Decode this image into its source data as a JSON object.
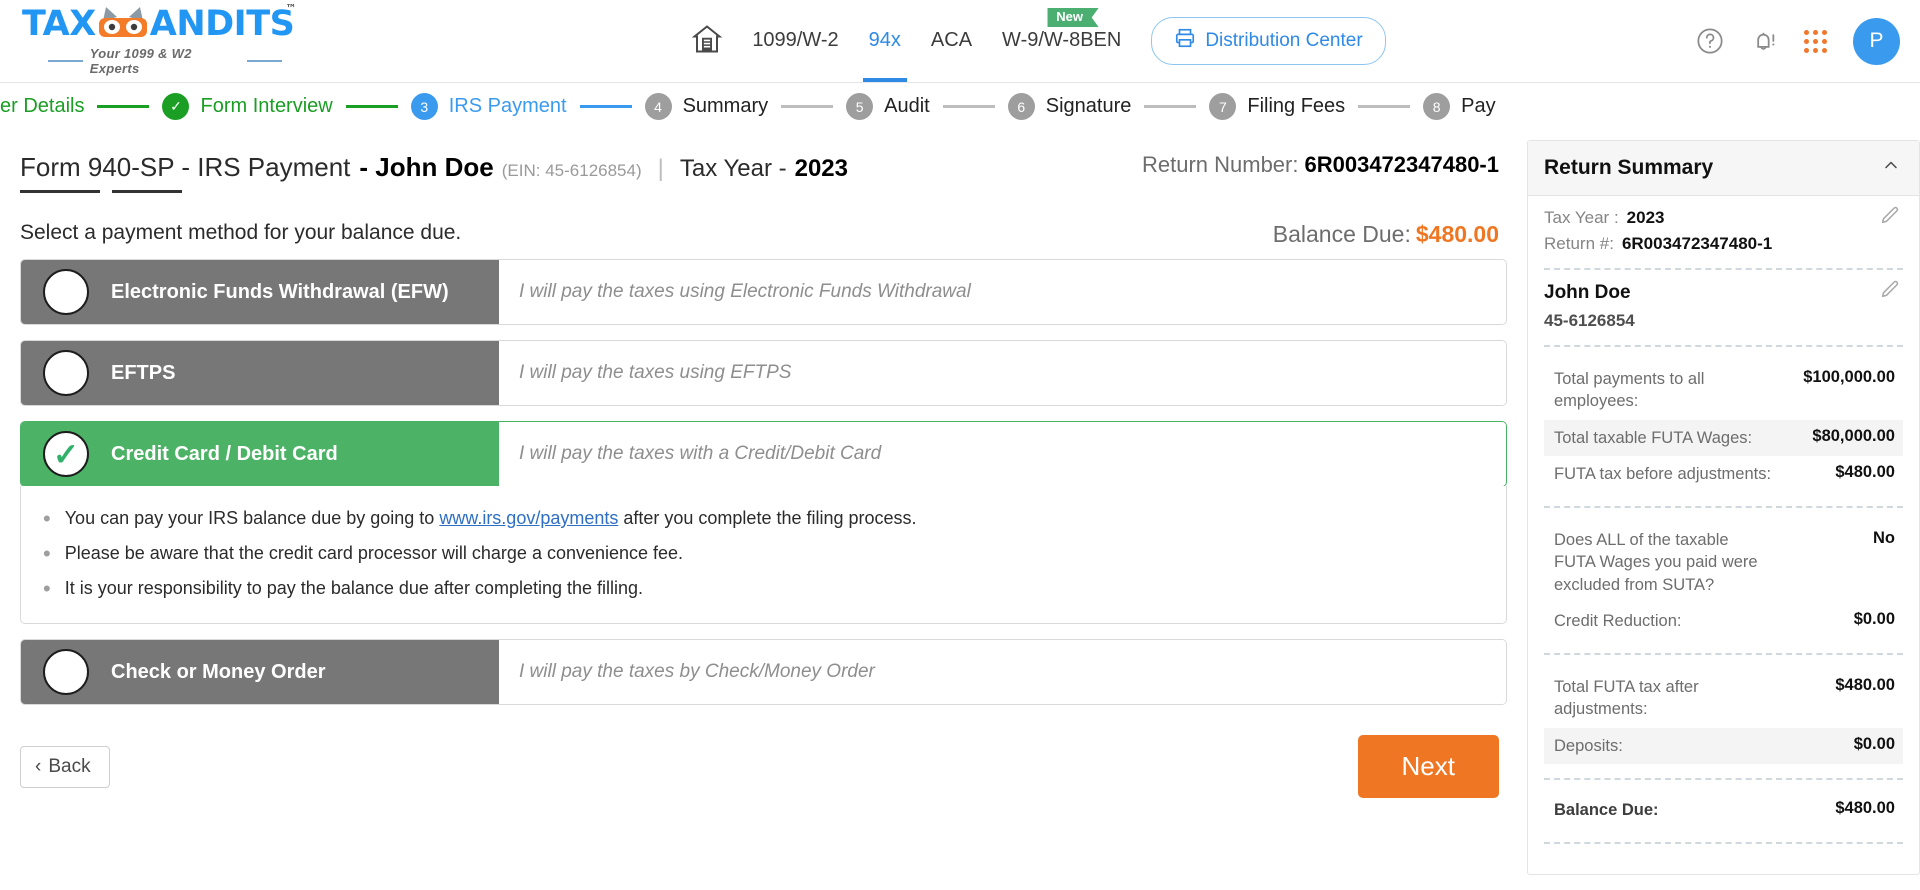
{
  "header": {
    "logo": {
      "text_main": "TAX ANDITS",
      "trademark": "™",
      "tagline": "Your 1099 & W2 Experts"
    },
    "nav": [
      {
        "label": "home-icon",
        "name": "nav-home",
        "active": false
      },
      {
        "label": "1099/W-2",
        "active": false
      },
      {
        "label": "94x",
        "active": true
      },
      {
        "label": "ACA",
        "active": false
      },
      {
        "label": "W-9/W-8BEN",
        "active": false,
        "badge": "New"
      }
    ],
    "distribution_button": "Distribution Center",
    "help_icon": "?",
    "avatar_initial": "P"
  },
  "steps": [
    {
      "num": "",
      "label": "yer Details",
      "state": "done"
    },
    {
      "num": "✓",
      "label": "Form Interview",
      "state": "done"
    },
    {
      "num": "3",
      "label": "IRS Payment",
      "state": "current"
    },
    {
      "num": "4",
      "label": "Summary",
      "state": "pending"
    },
    {
      "num": "5",
      "label": "Audit",
      "state": "pending"
    },
    {
      "num": "6",
      "label": "Signature",
      "state": "pending"
    },
    {
      "num": "7",
      "label": "Filing Fees",
      "state": "pending"
    },
    {
      "num": "8",
      "label": "Pay",
      "state": "pending"
    }
  ],
  "page": {
    "form_title": "Form 940-SP - IRS Payment",
    "business_name": "- John Doe",
    "ein": "(EIN: 45-6126854)",
    "separator": "|",
    "tax_year_label": "Tax Year -",
    "tax_year_value": "2023",
    "return_number_label": "Return Number:",
    "return_number_value": "6R003472347480-1",
    "select_prompt": "Select a payment method for your balance due.",
    "balance_due_label": "Balance Due:",
    "balance_due_value": "$480.00"
  },
  "payment_options": [
    {
      "label": "Electronic Funds Withdrawal (EFW)",
      "description": "I will pay the taxes using Electronic Funds Withdrawal",
      "selected": false
    },
    {
      "label": "EFTPS",
      "description": "I will pay the taxes using EFTPS",
      "selected": false
    },
    {
      "label": "Credit Card / Debit Card",
      "description": "I will pay the taxes with a Credit/Debit Card",
      "selected": true
    },
    {
      "label": "Check or Money Order",
      "description": "I will pay the taxes by Check/Money Order",
      "selected": false
    }
  ],
  "info_notes": {
    "note1_pre": "You can pay your IRS balance due by going to ",
    "note1_link": "www.irs.gov/payments",
    "note1_post": " after you complete the filing process.",
    "note2": "Please be aware that the credit card processor will charge a convenience fee.",
    "note3": "It is your responsibility to pay the balance due after completing the filling."
  },
  "footer": {
    "back_label": "Back",
    "next_label": "Next"
  },
  "sidebar": {
    "title": "Return Summary",
    "collapse_icon": "chevron-up",
    "tax_year_label": "Tax Year :",
    "tax_year_value": "2023",
    "return_label": "Return #:",
    "return_value": "6R003472347480-1",
    "business_name": "John Doe",
    "ein": "45-6126854",
    "rows_group1": [
      {
        "label": "Total payments to all employees:",
        "value": "$100,000.00",
        "shaded": false
      },
      {
        "label": "Total taxable FUTA Wages:",
        "value": "$80,000.00",
        "shaded": true
      },
      {
        "label": "FUTA tax before adjustments:",
        "value": "$480.00",
        "shaded": false
      }
    ],
    "rows_group2": [
      {
        "label": "Does ALL of the taxable FUTA Wages you paid were excluded from SUTA?",
        "value": "No",
        "shaded": false
      },
      {
        "label": "Credit Reduction:",
        "value": "$0.00",
        "shaded": false
      }
    ],
    "rows_group3": [
      {
        "label": "Total FUTA tax after adjustments:",
        "value": "$480.00",
        "shaded": false
      },
      {
        "label": "Deposits:",
        "value": "$0.00",
        "shaded": true
      }
    ],
    "balance_row": {
      "label": "Balance Due:",
      "value": "$480.00"
    }
  },
  "colors": {
    "brand_blue": "#2e8ae6",
    "accent_orange": "#ef7622",
    "selected_green": "#4cb265",
    "option_gray": "#777777",
    "step_done": "#1a9e23"
  }
}
